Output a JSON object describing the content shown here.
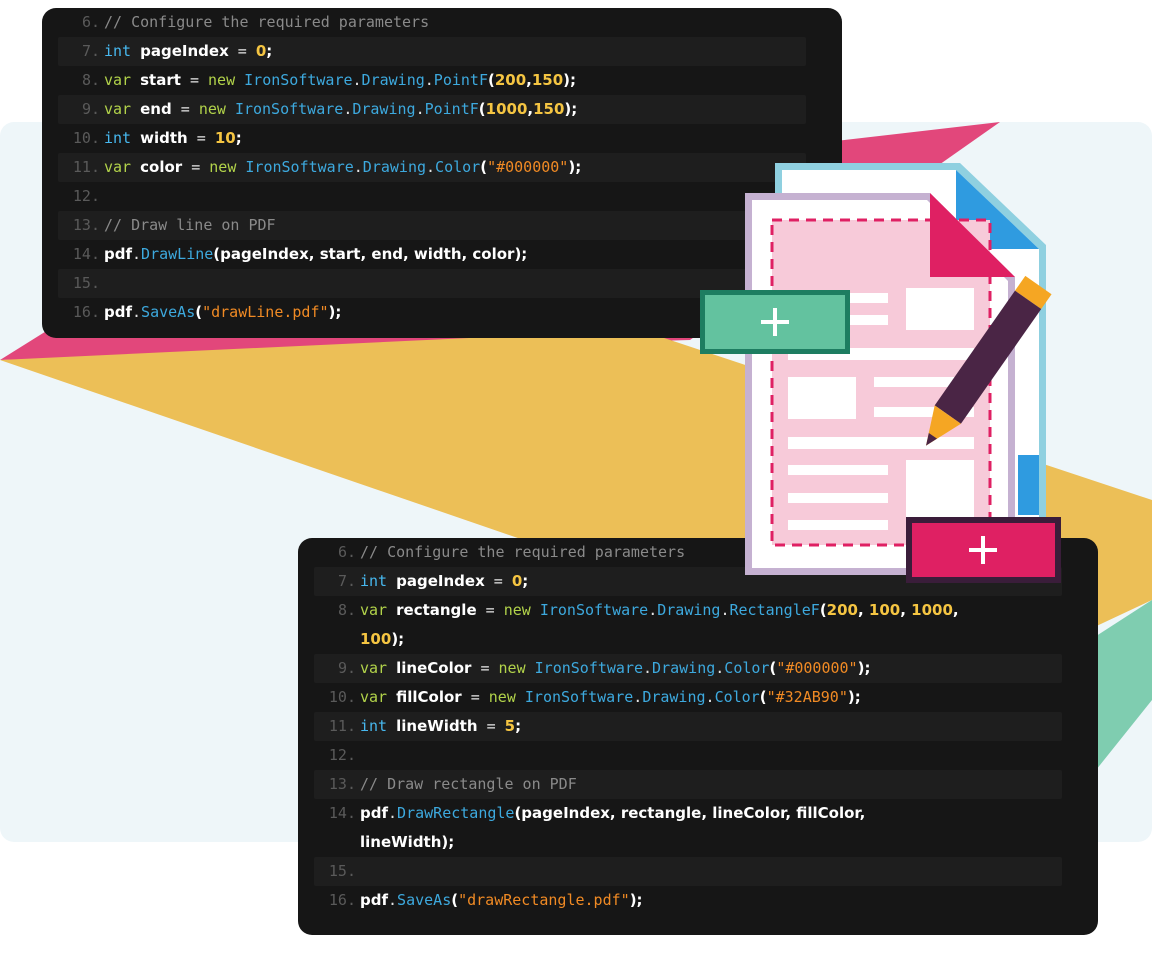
{
  "colors": {
    "pink": "#e2477b",
    "yellow": "#ecbf57",
    "teal": "#7fcdb0",
    "background_panel": "#eef6f9",
    "code_background": "#161616",
    "add_green": "#63c29f",
    "add_magenta": "#df2063",
    "pencil_body": "#4a2545",
    "pencil_tip": "#f5a623"
  },
  "icons": {
    "document": "pdf-document-icon",
    "pencil": "pencil-icon",
    "add_green": "plus-icon",
    "add_magenta": "plus-icon"
  },
  "code_top": [
    {
      "n": "6.",
      "tokens": [
        {
          "t": "// Configure the required parameters",
          "c": "comment"
        }
      ]
    },
    {
      "n": "7.",
      "tokens": [
        {
          "t": "int ",
          "c": "keyword"
        },
        {
          "t": "pageIndex",
          "c": "ident"
        },
        {
          "t": " = ",
          "c": "plain"
        },
        {
          "t": "0",
          "c": "number"
        },
        {
          "t": ";",
          "c": "punct"
        }
      ]
    },
    {
      "n": "8.",
      "tokens": [
        {
          "t": "var ",
          "c": "var"
        },
        {
          "t": "start",
          "c": "ident"
        },
        {
          "t": " = ",
          "c": "plain"
        },
        {
          "t": "new ",
          "c": "new"
        },
        {
          "t": "IronSoftware",
          "c": "class"
        },
        {
          "t": ".",
          "c": "plain"
        },
        {
          "t": "Drawing",
          "c": "class"
        },
        {
          "t": ".",
          "c": "plain"
        },
        {
          "t": "PointF",
          "c": "class"
        },
        {
          "t": "(",
          "c": "punct"
        },
        {
          "t": "200",
          "c": "number"
        },
        {
          "t": ",",
          "c": "punct"
        },
        {
          "t": "150",
          "c": "number"
        },
        {
          "t": ");",
          "c": "punct"
        }
      ]
    },
    {
      "n": "9.",
      "tokens": [
        {
          "t": "var ",
          "c": "var"
        },
        {
          "t": "end",
          "c": "ident"
        },
        {
          "t": " = ",
          "c": "plain"
        },
        {
          "t": "new ",
          "c": "new"
        },
        {
          "t": "IronSoftware",
          "c": "class"
        },
        {
          "t": ".",
          "c": "plain"
        },
        {
          "t": "Drawing",
          "c": "class"
        },
        {
          "t": ".",
          "c": "plain"
        },
        {
          "t": "PointF",
          "c": "class"
        },
        {
          "t": "(",
          "c": "punct"
        },
        {
          "t": "1000",
          "c": "number"
        },
        {
          "t": ",",
          "c": "punct"
        },
        {
          "t": "150",
          "c": "number"
        },
        {
          "t": ");",
          "c": "punct"
        }
      ]
    },
    {
      "n": "10.",
      "tokens": [
        {
          "t": "int ",
          "c": "keyword"
        },
        {
          "t": "width",
          "c": "ident"
        },
        {
          "t": " = ",
          "c": "plain"
        },
        {
          "t": "10",
          "c": "number"
        },
        {
          "t": ";",
          "c": "punct"
        }
      ]
    },
    {
      "n": "11.",
      "tokens": [
        {
          "t": "var ",
          "c": "var"
        },
        {
          "t": "color",
          "c": "ident"
        },
        {
          "t": " = ",
          "c": "plain"
        },
        {
          "t": "new ",
          "c": "new"
        },
        {
          "t": "IronSoftware",
          "c": "class"
        },
        {
          "t": ".",
          "c": "plain"
        },
        {
          "t": "Drawing",
          "c": "class"
        },
        {
          "t": ".",
          "c": "plain"
        },
        {
          "t": "Color",
          "c": "class"
        },
        {
          "t": "(",
          "c": "punct"
        },
        {
          "t": "\"#000000\"",
          "c": "string"
        },
        {
          "t": ");",
          "c": "punct"
        }
      ]
    },
    {
      "n": "12.",
      "tokens": []
    },
    {
      "n": "13.",
      "tokens": [
        {
          "t": "// Draw line on PDF",
          "c": "comment"
        }
      ]
    },
    {
      "n": "14.",
      "tokens": [
        {
          "t": "pdf",
          "c": "ident"
        },
        {
          "t": ".",
          "c": "plain"
        },
        {
          "t": "DrawLine",
          "c": "method"
        },
        {
          "t": "(pageIndex, start, end, width, color);",
          "c": "punct"
        }
      ]
    },
    {
      "n": "15.",
      "tokens": []
    },
    {
      "n": "16.",
      "tokens": [
        {
          "t": "pdf",
          "c": "ident"
        },
        {
          "t": ".",
          "c": "plain"
        },
        {
          "t": "SaveAs",
          "c": "method"
        },
        {
          "t": "(",
          "c": "punct"
        },
        {
          "t": "\"drawLine.pdf\"",
          "c": "string"
        },
        {
          "t": ");",
          "c": "punct"
        }
      ]
    }
  ],
  "code_bottom": [
    {
      "n": "6.",
      "tokens": [
        {
          "t": "// Configure the required parameters",
          "c": "comment"
        }
      ]
    },
    {
      "n": "7.",
      "tokens": [
        {
          "t": "int ",
          "c": "keyword"
        },
        {
          "t": "pageIndex",
          "c": "ident"
        },
        {
          "t": " = ",
          "c": "plain"
        },
        {
          "t": "0",
          "c": "number"
        },
        {
          "t": ";",
          "c": "punct"
        }
      ]
    },
    {
      "n": "8.",
      "tokens": [
        {
          "t": "var ",
          "c": "var"
        },
        {
          "t": "rectangle",
          "c": "ident"
        },
        {
          "t": " = ",
          "c": "plain"
        },
        {
          "t": "new ",
          "c": "new"
        },
        {
          "t": "IronSoftware",
          "c": "class"
        },
        {
          "t": ".",
          "c": "plain"
        },
        {
          "t": "Drawing",
          "c": "class"
        },
        {
          "t": ".",
          "c": "plain"
        },
        {
          "t": "RectangleF",
          "c": "class"
        },
        {
          "t": "(",
          "c": "punct"
        },
        {
          "t": "200",
          "c": "number"
        },
        {
          "t": ", ",
          "c": "punct"
        },
        {
          "t": "100",
          "c": "number"
        },
        {
          "t": ", ",
          "c": "punct"
        },
        {
          "t": "1000",
          "c": "number"
        },
        {
          "t": ",",
          "c": "punct"
        }
      ],
      "wrap": [
        {
          "t": "100",
          "c": "number"
        },
        {
          "t": ");",
          "c": "punct"
        }
      ]
    },
    {
      "n": "9.",
      "tokens": [
        {
          "t": "var ",
          "c": "var"
        },
        {
          "t": "lineColor",
          "c": "ident"
        },
        {
          "t": " = ",
          "c": "plain"
        },
        {
          "t": "new ",
          "c": "new"
        },
        {
          "t": "IronSoftware",
          "c": "class"
        },
        {
          "t": ".",
          "c": "plain"
        },
        {
          "t": "Drawing",
          "c": "class"
        },
        {
          "t": ".",
          "c": "plain"
        },
        {
          "t": "Color",
          "c": "class"
        },
        {
          "t": "(",
          "c": "punct"
        },
        {
          "t": "\"#000000\"",
          "c": "string"
        },
        {
          "t": ");",
          "c": "punct"
        }
      ]
    },
    {
      "n": "10.",
      "tokens": [
        {
          "t": "var ",
          "c": "var"
        },
        {
          "t": "fillColor",
          "c": "ident"
        },
        {
          "t": " = ",
          "c": "plain"
        },
        {
          "t": "new ",
          "c": "new"
        },
        {
          "t": "IronSoftware",
          "c": "class"
        },
        {
          "t": ".",
          "c": "plain"
        },
        {
          "t": "Drawing",
          "c": "class"
        },
        {
          "t": ".",
          "c": "plain"
        },
        {
          "t": "Color",
          "c": "class"
        },
        {
          "t": "(",
          "c": "punct"
        },
        {
          "t": "\"#32AB90\"",
          "c": "string"
        },
        {
          "t": ");",
          "c": "punct"
        }
      ]
    },
    {
      "n": "11.",
      "tokens": [
        {
          "t": "int ",
          "c": "keyword"
        },
        {
          "t": "lineWidth",
          "c": "ident"
        },
        {
          "t": " = ",
          "c": "plain"
        },
        {
          "t": "5",
          "c": "number"
        },
        {
          "t": ";",
          "c": "punct"
        }
      ]
    },
    {
      "n": "12.",
      "tokens": []
    },
    {
      "n": "13.",
      "tokens": [
        {
          "t": "// Draw rectangle on PDF",
          "c": "comment"
        }
      ]
    },
    {
      "n": "14.",
      "tokens": [
        {
          "t": "pdf",
          "c": "ident"
        },
        {
          "t": ".",
          "c": "plain"
        },
        {
          "t": "DrawRectangle",
          "c": "method"
        },
        {
          "t": "(pageIndex, rectangle, lineColor, fillColor,",
          "c": "punct"
        }
      ],
      "wrap": [
        {
          "t": "lineWidth);",
          "c": "punct"
        }
      ]
    },
    {
      "n": "15.",
      "tokens": []
    },
    {
      "n": "16.",
      "tokens": [
        {
          "t": "pdf",
          "c": "ident"
        },
        {
          "t": ".",
          "c": "plain"
        },
        {
          "t": "SaveAs",
          "c": "method"
        },
        {
          "t": "(",
          "c": "punct"
        },
        {
          "t": "\"drawRectangle.pdf\"",
          "c": "string"
        },
        {
          "t": ");",
          "c": "punct"
        }
      ]
    }
  ]
}
